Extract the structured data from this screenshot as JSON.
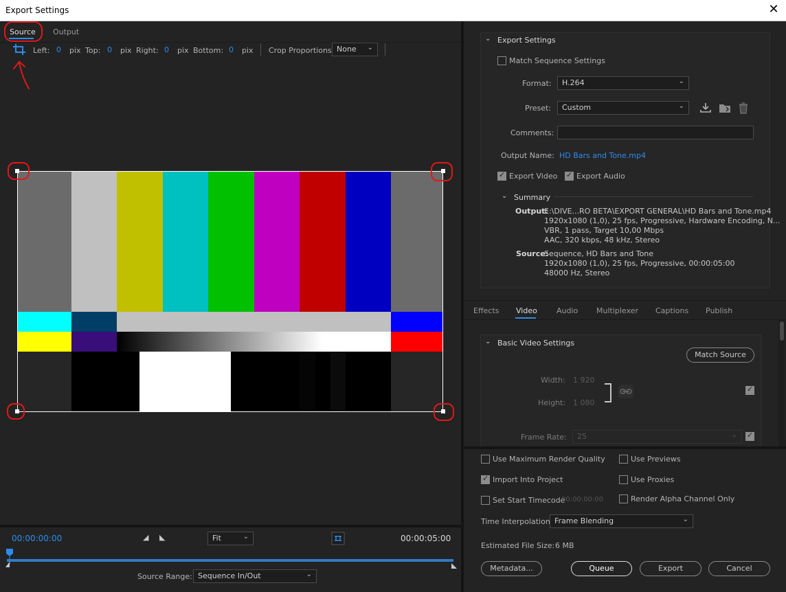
{
  "window": {
    "title": "Export Settings",
    "close_glyph": "✕"
  },
  "preview": {
    "tabs": [
      "Source",
      "Output"
    ],
    "crop": {
      "left_label": "Left:",
      "left_value": "0",
      "top_label": "Top:",
      "top_value": "0",
      "right_label": "Right:",
      "right_value": "0",
      "bottom_label": "Bottom:",
      "bottom_value": "0",
      "unit": "pix",
      "proportions_label": "Crop Proportions:",
      "proportions_value": "None"
    },
    "timeline": {
      "start_time": "00:00:00:00",
      "end_time": "00:00:05:00",
      "zoom_value": "Fit",
      "source_range_label": "Source Range:",
      "source_range_value": "Sequence In/Out"
    },
    "colors": {
      "top_bars": [
        "#6b6b6b",
        "#c0c0c0",
        "#c0c000",
        "#00c0c0",
        "#00c000",
        "#c000c0",
        "#c00000",
        "#0000c0",
        "#6b6b6b"
      ],
      "accent": "#2d8ceb",
      "annotation_red": "#e01818"
    }
  },
  "export_settings": {
    "section_title": "Export Settings",
    "match_sequence_label": "Match Sequence Settings",
    "format_label": "Format:",
    "format_value": "H.264",
    "preset_label": "Preset:",
    "preset_value": "Custom",
    "comments_label": "Comments:",
    "comments_value": "",
    "output_name_label": "Output Name:",
    "output_name_value": "HD Bars and Tone.mp4",
    "export_video_label": "Export Video",
    "export_audio_label": "Export Audio",
    "summary_title": "Summary",
    "summary_output_label": "Output:",
    "summary_output_lines": [
      "E:\\DIVE...RO BETA\\EXPORT GENERAL\\HD Bars and Tone.mp4",
      "1920x1080 (1,0), 25 fps, Progressive, Hardware Encoding, N...",
      "VBR, 1 pass, Target 10,00 Mbps",
      "AAC, 320 kbps, 48 kHz, Stereo"
    ],
    "summary_source_label": "Source:",
    "summary_source_lines": [
      "Sequence, HD Bars and Tone",
      "1920x1080 (1,0), 25 fps, Progressive, 00:00:05:00",
      "48000 Hz, Stereo"
    ]
  },
  "settings_tabs": [
    "Effects",
    "Video",
    "Audio",
    "Multiplexer",
    "Captions",
    "Publish"
  ],
  "video": {
    "section_title": "Basic Video Settings",
    "match_source_label": "Match Source",
    "width_label": "Width:",
    "width_value": "1 920",
    "height_label": "Height:",
    "height_value": "1 080",
    "frame_rate_label": "Frame Rate:",
    "frame_rate_value": "25"
  },
  "options": {
    "max_render_quality": "Use Maximum Render Quality",
    "use_previews": "Use Previews",
    "import_into_project": "Import Into Project",
    "use_proxies": "Use Proxies",
    "set_start_timecode": "Set Start Timecode",
    "start_timecode_value": "00:00:00:00",
    "render_alpha": "Render Alpha Channel Only",
    "time_interpolation_label": "Time Interpolation:",
    "time_interpolation_value": "Frame Blending",
    "estimated_size_label": "Estimated File Size:",
    "estimated_size_value": "6 MB"
  },
  "buttons": {
    "metadata": "Metadata...",
    "queue": "Queue",
    "export": "Export",
    "cancel": "Cancel"
  }
}
